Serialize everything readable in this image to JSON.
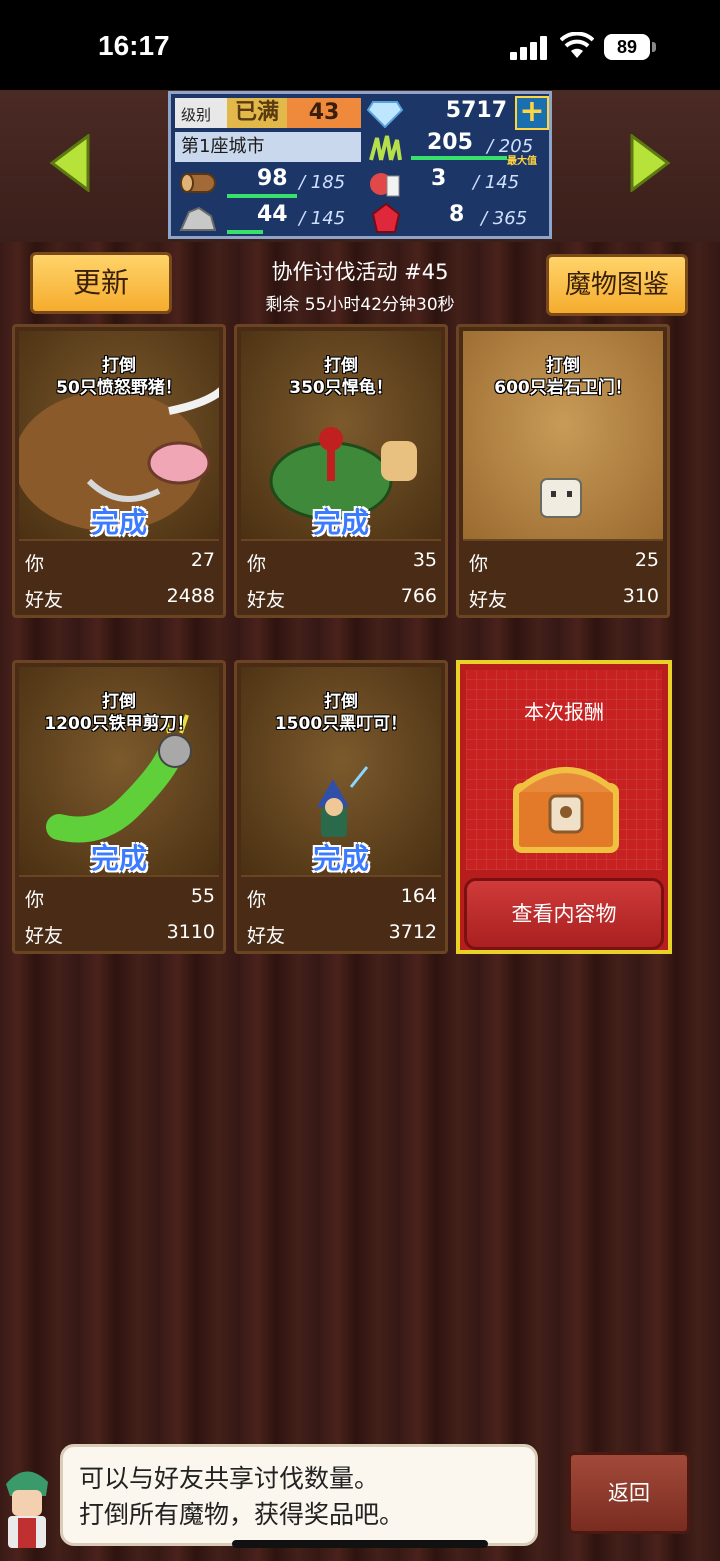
{
  "status_bar": {
    "time": "16:17",
    "battery": "89"
  },
  "stats": {
    "level_label": "级别",
    "level_max": "已满",
    "level": "43",
    "gems": "5717",
    "plus": "+",
    "city": "第1座城市",
    "grass": "205",
    "grass_max": "/ 205",
    "grass_max_tag": "最大值",
    "wood": "98",
    "wood_max": "/ 185",
    "food": "3",
    "food_max": "/ 145",
    "ore": "44",
    "ore_max": "/ 145",
    "ruby": "8",
    "ruby_max": "/ 365"
  },
  "header": {
    "refresh_label": "更新",
    "event_title": "协作讨伐活动 #45",
    "remaining": "剩余 55小时42分钟30秒",
    "monster_book_label": "魔物图鉴"
  },
  "labels": {
    "you": "你",
    "friends": "好友",
    "done": "完成"
  },
  "missions": [
    {
      "goal_line1": "打倒",
      "goal_line2": "50只愤怒野猪！",
      "you": "27",
      "friends": "2488",
      "done": true
    },
    {
      "goal_line1": "打倒",
      "goal_line2": "350只悍龟！",
      "you": "35",
      "friends": "766",
      "done": true
    },
    {
      "goal_line1": "打倒",
      "goal_line2": "600只岩石卫门！",
      "you": "25",
      "friends": "310",
      "done": false
    },
    {
      "goal_line1": "打倒",
      "goal_line2": "1200只铁甲剪刀！",
      "you": "55",
      "friends": "3110",
      "done": true
    },
    {
      "goal_line1": "打倒",
      "goal_line2": "1500只黑叮可！",
      "you": "164",
      "friends": "3712",
      "done": true
    }
  ],
  "reward": {
    "title": "本次报酬",
    "view_label": "查看内容物"
  },
  "tip": {
    "line1": "可以与好友共享讨伐数量。",
    "line2": "打倒所有魔物，获得奖品吧。"
  },
  "back_label": "返回"
}
